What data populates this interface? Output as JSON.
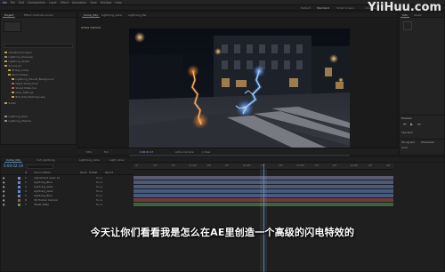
{
  "menubar": {
    "items": [
      "Ae",
      "File",
      "Edit",
      "Composition",
      "Layer",
      "Effect",
      "Animation",
      "View",
      "Window",
      "Help"
    ]
  },
  "workspaces": [
    "Default",
    "Standard",
    "Small Screen",
    "Libraries",
    "Search Help"
  ],
  "watermark": "YiiHuu.com",
  "project_panel": {
    "tabs": [
      "Project",
      "Effect Controls (none)"
    ],
    "items": [
      {
        "label": "Adjustment Layers",
        "color": "#b4a04a"
      },
      {
        "label": "Lightning_Glow.aep",
        "color": "#8a8a8a"
      },
      {
        "label": "Lightning_Assets",
        "color": "#b4a04a"
      },
      {
        "label": "Source_01",
        "color": "#b4a04a"
      },
      {
        "label": "Bridge_Comp",
        "color": "#b4a04a"
      },
      {
        "label": "Bolt_Footage",
        "color": "#b4a04a"
      },
      {
        "label": "Lightning_Tutorial_Background",
        "color": "#c8a050"
      },
      {
        "label": "Night_Street_Final",
        "color": "#b85a5a"
      },
      {
        "label": "Street_Plate.mov",
        "color": "#b85a5a"
      },
      {
        "label": "Glow_Settings",
        "color": "#c8a050"
      },
      {
        "label": "Bolt_Path_Buildings.aep",
        "color": "#c8a050"
      },
      {
        "label": "Solids",
        "color": "#b4a04a"
      },
      {
        "label": "Lightning_Glow",
        "color": "#8a8a8a"
      },
      {
        "label": "Lightning_Shadow",
        "color": "#8a8a8a"
      }
    ]
  },
  "viewer": {
    "tabs": [
      "Comp_City",
      "Lightning_Glow",
      "Lightning_Bar"
    ],
    "title": "Active Camera",
    "zoom": "50%",
    "timecode": "0:00:01:17",
    "quality": "Full",
    "camera": "Active Camera",
    "view": "1 View"
  },
  "right_panel": {
    "tabs": [
      "Info",
      "Audio"
    ],
    "preview_label": "Preview",
    "character_label": "Character",
    "paragraph_label": "Paragraph",
    "font": "Arial",
    "shortcut": "Spacebar"
  },
  "timeline": {
    "tabs": [
      "Comp_City",
      "Cut_Lightning",
      "Lightning_Glow",
      "Light_Glow"
    ],
    "timecode": "0:00:02:18",
    "col_headers": [
      "#",
      "Source Name",
      "Mode",
      "T",
      "TrkMat",
      "Parent"
    ],
    "layers": [
      {
        "num": "1",
        "name": "Adjustment Layer 12",
        "mode": "None",
        "color": "#8a8ab4"
      },
      {
        "num": "2",
        "name": "Lightning_Blue",
        "mode": "None",
        "color": "#6b8ac8"
      },
      {
        "num": "3",
        "name": "Lightning_Glow",
        "mode": "None",
        "color": "#6b8ac8"
      },
      {
        "num": "4",
        "name": "Lightning_Glow",
        "mode": "None",
        "color": "#6b8ac8"
      },
      {
        "num": "5",
        "name": "Lightning_Blue",
        "mode": "None",
        "color": "#6b8ac8"
      },
      {
        "num": "6",
        "name": "3D Tracker Camera",
        "mode": "None",
        "color": "#b05050"
      },
      {
        "num": "7",
        "name": "Street_Plate",
        "mode": "None",
        "color": "#5a9a5a"
      }
    ],
    "ruler_ticks": [
      "0f",
      "10f",
      "20f",
      "01:00f",
      "10f",
      "20f",
      "02:00f",
      "10f",
      "20f",
      "03:00f",
      "10f",
      "20f",
      "04:00f",
      "10f",
      "20f"
    ],
    "bar_colors": [
      "#8a8ab4",
      "#6b8ac8",
      "#6b8ac8",
      "#6b8ac8",
      "#6b8ac8",
      "#b05050",
      "#5a9a5a"
    ],
    "playhead_fraction": 0.5
  },
  "subtitle": "今天让你们看看我是怎么在AE里创造一个高级的闪电特效的"
}
